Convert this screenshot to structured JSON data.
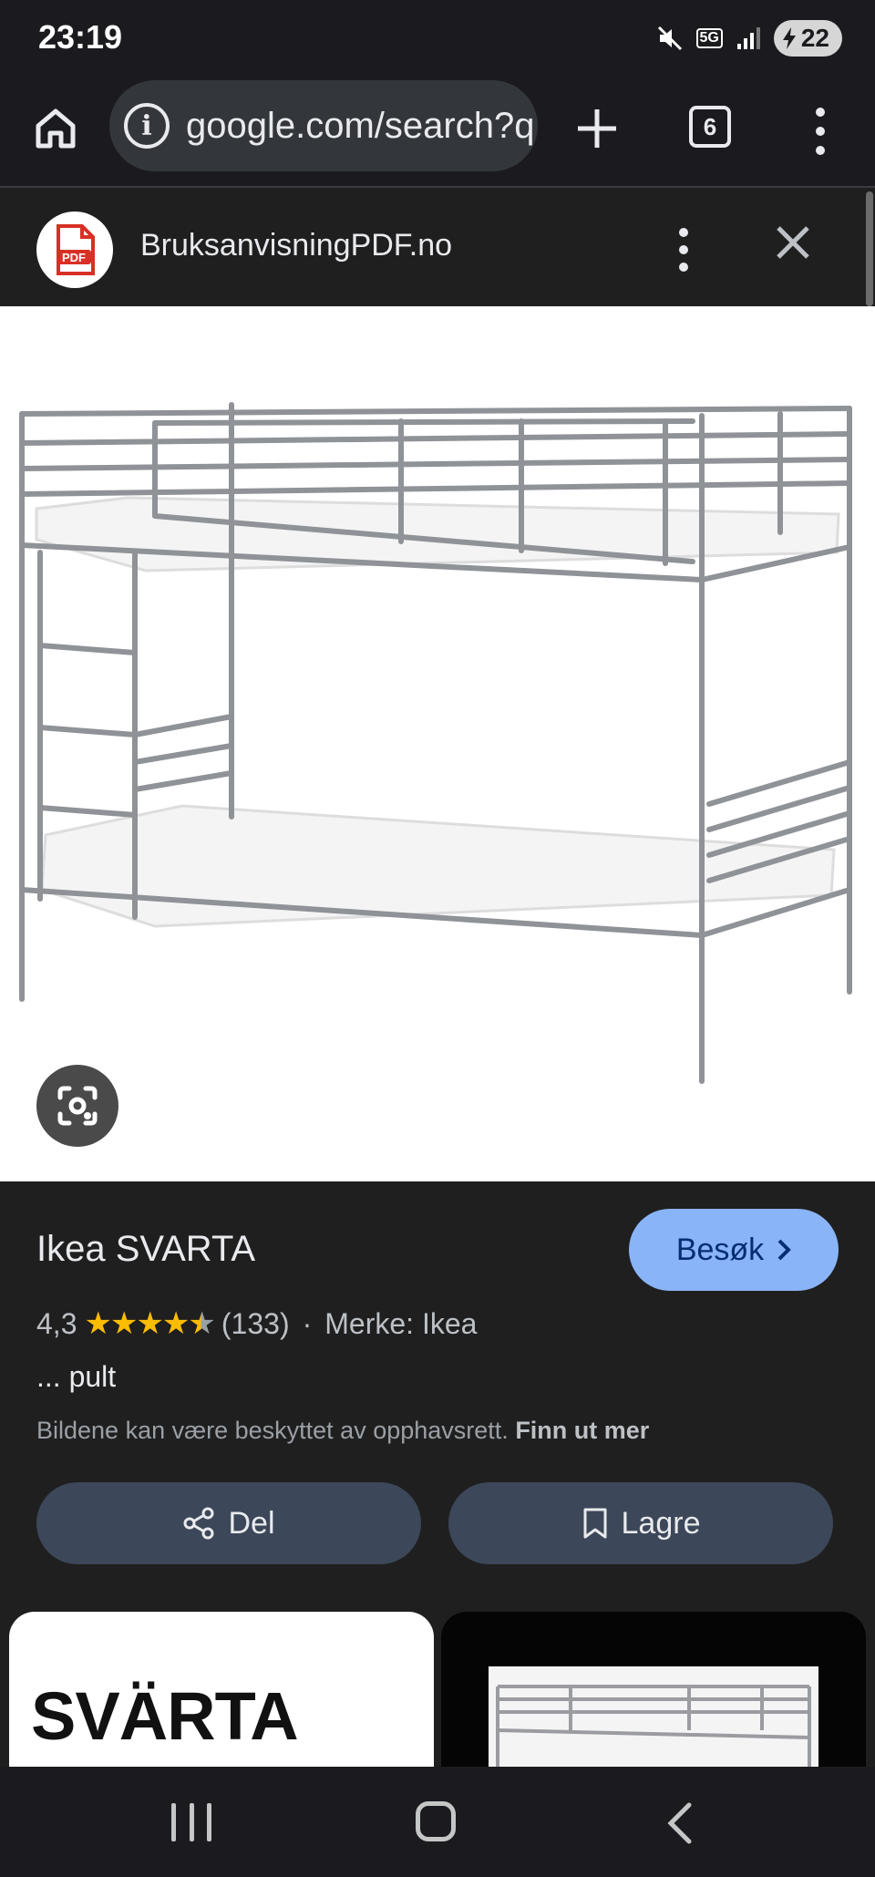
{
  "status_bar": {
    "time": "23:19",
    "network": "5G",
    "battery": "22"
  },
  "browser": {
    "url": "google.com/search?q",
    "tab_count": "6"
  },
  "source": {
    "logo_text": "PDF",
    "name": "BruksanvisningPDF.no"
  },
  "result": {
    "title": "Ikea SVARTA",
    "visit_label": "Besøk",
    "rating": "4,3",
    "review_count": "(133)",
    "separator": "·",
    "brand": "Merke: Ikea",
    "snippet": "... pult",
    "copyright_text": "Bildene kan være beskyttet av opphavsrett.",
    "copyright_link": "Finn ut mer",
    "share_label": "Del",
    "save_label": "Lagre"
  },
  "related": {
    "thumb1_text": "SVÄRTA"
  },
  "colors": {
    "accent": "#8ab4f8",
    "action_button": "#3c4759",
    "star": "#fbbc04"
  },
  "icons": [
    "home-icon",
    "info-icon",
    "plus-icon",
    "tab-switcher-icon",
    "more-vert-icon",
    "pdf-logo-icon",
    "close-icon",
    "lens-icon",
    "chevron-right-icon",
    "share-icon",
    "bookmark-icon",
    "recents-icon",
    "home-nav-icon",
    "back-icon"
  ]
}
